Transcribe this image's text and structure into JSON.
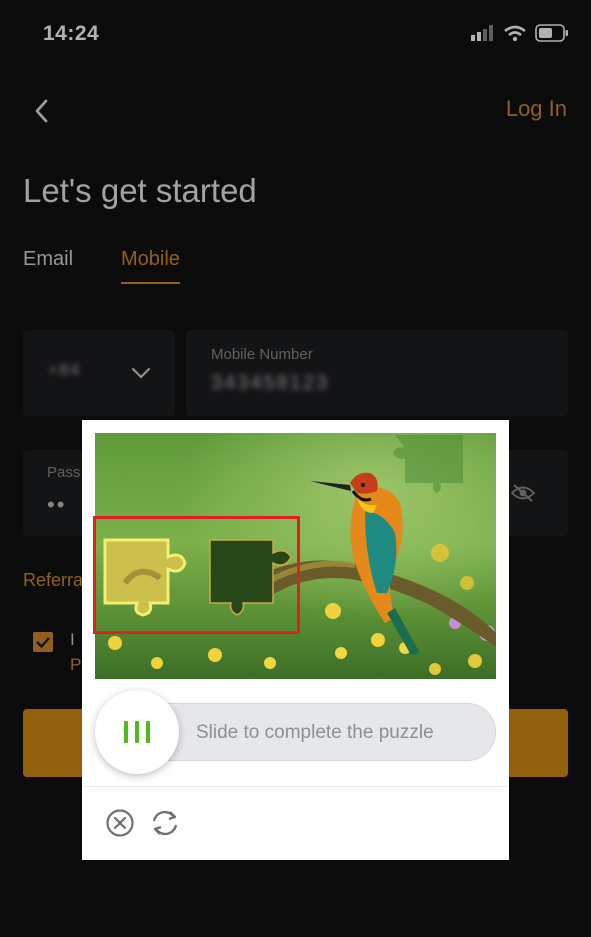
{
  "status_bar": {
    "time": "14:24"
  },
  "nav": {
    "login_label": "Log In"
  },
  "page": {
    "title": "Let's get started"
  },
  "tabs": [
    {
      "label": "Email",
      "active": false
    },
    {
      "label": "Mobile",
      "active": true
    }
  ],
  "form": {
    "country_code_value": "+84",
    "mobile_label": "Mobile Number",
    "mobile_value": "343458123",
    "password_label": "Pass",
    "password_value": "••",
    "referral_label": "Referra",
    "agree_line1": "I",
    "agree_line2": "P"
  },
  "captcha": {
    "slider_text": "Slide to complete the puzzle"
  },
  "colors": {
    "accent": "#d08a2b",
    "slider_green": "#56b71b",
    "highlight_red": "#e02020"
  }
}
